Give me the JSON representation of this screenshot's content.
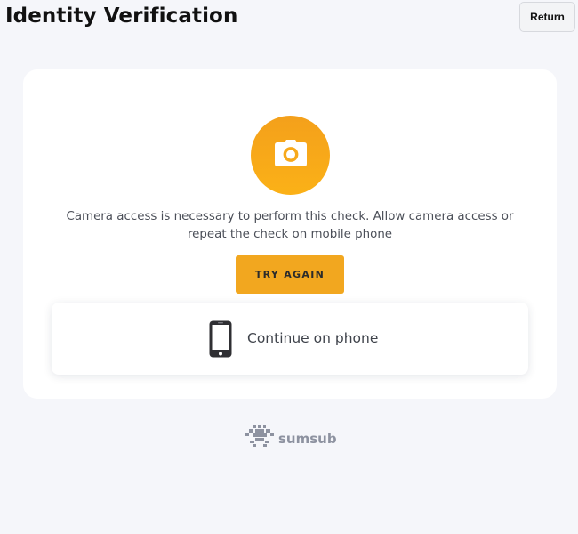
{
  "header": {
    "title": "Identity Verification",
    "return_label": "Return"
  },
  "card": {
    "camera_icon": "camera-icon",
    "message": "Camera access is necessary to perform this check. Allow camera access or repeat the check on mobile phone",
    "try_again_label": "TRY AGAIN",
    "phone_option": {
      "icon": "smartphone-icon",
      "label": "Continue on phone"
    }
  },
  "footer": {
    "brand_logo": "sumsub-logo-icon",
    "brand_name": "sumsub"
  },
  "colors": {
    "background": "#f5f6fa",
    "card": "#ffffff",
    "accent": "#f2a71f",
    "text": "#4b4f58",
    "brand": "#8d92a0"
  }
}
